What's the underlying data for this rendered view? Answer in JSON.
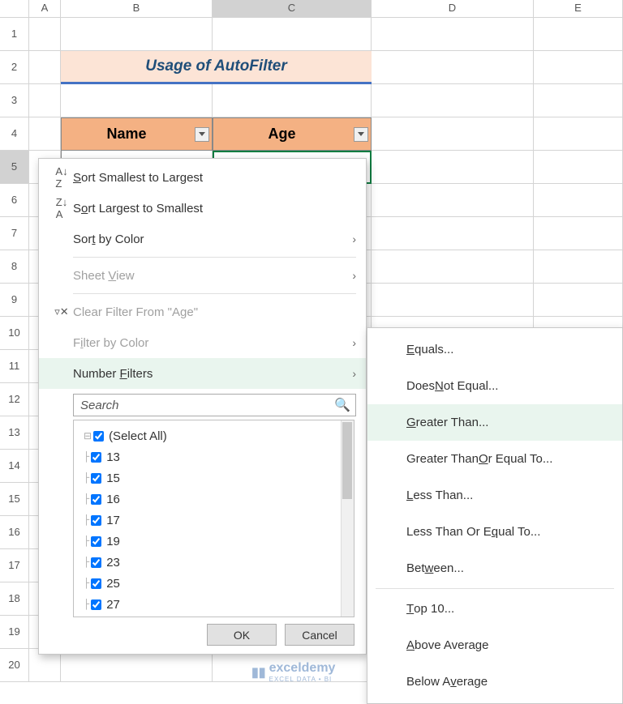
{
  "columns": [
    "A",
    "B",
    "C",
    "D",
    "E"
  ],
  "rows": [
    "1",
    "2",
    "3",
    "4",
    "5",
    "6",
    "7",
    "8",
    "9",
    "10",
    "11",
    "12",
    "13",
    "14",
    "15",
    "16",
    "17",
    "18",
    "19",
    "20"
  ],
  "title": "Usage of AutoFilter",
  "headers": {
    "name": "Name",
    "age": "Age"
  },
  "menu1": {
    "sort_asc": "Sort Smallest to Largest",
    "sort_desc": "Sort Largest to Smallest",
    "sort_color": "Sort by Color",
    "sheet_view": "Sheet View",
    "clear_filter": "Clear Filter From \"Age\"",
    "filter_color": "Filter by Color",
    "number_filters": "Number Filters",
    "search_placeholder": "Search",
    "select_all": "(Select All)",
    "values": [
      "13",
      "15",
      "16",
      "17",
      "19",
      "23",
      "25",
      "27"
    ],
    "ok": "OK",
    "cancel": "Cancel"
  },
  "menu2": {
    "equals": "Equals...",
    "not_equal": "Does Not Equal...",
    "greater": "Greater Than...",
    "greater_eq": "Greater Than Or Equal To...",
    "less": "Less Than...",
    "less_eq": "Less Than Or Equal To...",
    "between": "Between...",
    "top10": "Top 10...",
    "above_avg": "Above Average",
    "below_avg": "Below Average"
  },
  "watermark": {
    "brand": "exceldemy",
    "tag": "EXCEL DATA • BI"
  }
}
